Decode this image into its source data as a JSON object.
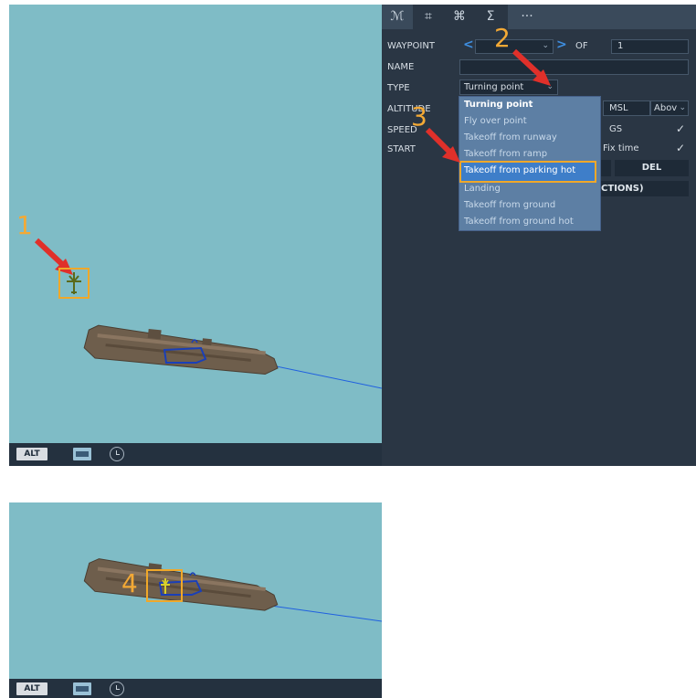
{
  "tabs": [
    {
      "icon": "route-icon",
      "glyph": "ℳ"
    },
    {
      "icon": "triggers-icon",
      "glyph": "⌗"
    },
    {
      "icon": "commands-icon",
      "glyph": "⌘"
    },
    {
      "icon": "sum-icon",
      "glyph": "Σ"
    },
    {
      "icon": "more-icon",
      "glyph": "···"
    }
  ],
  "waypoint_panel": {
    "waypoint_label": "WAYPOINT",
    "of_label": "OF",
    "of_value": "1",
    "name_label": "NAME",
    "name_value": "",
    "type_label": "TYPE",
    "type_value": "Turning point",
    "altitude_label": "ALTITUDE",
    "altitude_ref": "MSL",
    "altitude_mode": "Abov",
    "speed_label": "SPEED",
    "speed_ref": "GS",
    "start_label": "START",
    "fix_time_label": "Fix time",
    "del_label": "DEL",
    "actions_label": "T ACTIONS)"
  },
  "type_options": [
    "Turning point",
    "Fly over point",
    "Takeoff from runway",
    "Takeoff from ramp",
    "Takeoff from parking hot",
    "Landing",
    "Takeoff from ground",
    "Takeoff from ground hot"
  ],
  "selected_option_index": 0,
  "highlighted_option_index": 4,
  "bottom_bar": {
    "alt_label": "ALT"
  },
  "annotations": {
    "step1": "1",
    "step2": "2",
    "step3": "3",
    "step4": "4"
  },
  "colors": {
    "map_water": "#7fbcc6",
    "panel_bg": "#2a3644",
    "annotation_orange": "#f0a829",
    "arrow_red": "#e0302a",
    "route_blue": "#1f5fe0",
    "dropdown_bg": "#5d7fa4",
    "highlight_bg": "#3e7ec9"
  }
}
